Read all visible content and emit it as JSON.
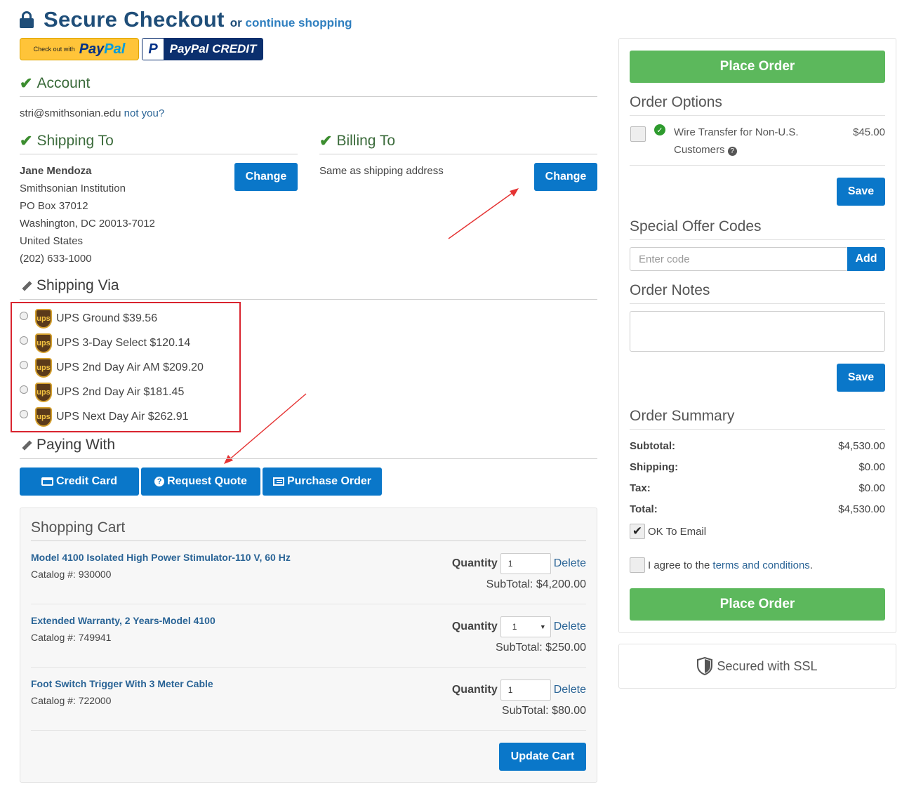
{
  "header": {
    "title": "Secure Checkout",
    "or_text": "or",
    "continue_link": "continue shopping"
  },
  "paypal": {
    "checkout_small": "Check out with",
    "pay": "Pay",
    "pal": "Pal",
    "credit_mark": "P",
    "credit_label": "PayPal CREDIT"
  },
  "account": {
    "heading": "Account",
    "email": "stri@smithsonian.edu",
    "not_you": "not you?"
  },
  "shipping_to": {
    "heading": "Shipping To",
    "name": "Jane Mendoza",
    "lines": [
      "Smithsonian Institution",
      "PO Box 37012",
      "Washington, DC 20013-7012",
      "United States",
      "(202) 633-1000"
    ],
    "change": "Change"
  },
  "billing_to": {
    "heading": "Billing To",
    "text": "Same as shipping address",
    "change": "Change"
  },
  "shipping_via": {
    "heading": "Shipping Via",
    "logo": "ups",
    "options": [
      "UPS Ground $39.56",
      "UPS 3-Day Select $120.14",
      "UPS 2nd Day Air AM $209.20",
      "UPS 2nd Day Air $181.45",
      "UPS Next Day Air $262.91"
    ]
  },
  "paying_with": {
    "heading": "Paying With",
    "credit_card": "Credit Card",
    "request_quote": "Request Quote",
    "purchase_order": "Purchase Order"
  },
  "cart": {
    "title": "Shopping Cart",
    "quantity_label": "Quantity",
    "delete_label": "Delete",
    "items": [
      {
        "name": "Model 4100 Isolated High Power Stimulator-110 V, 60 Hz",
        "catalog": "Catalog #: 930000",
        "qty": "1",
        "subtotal": "SubTotal: $4,200.00"
      },
      {
        "name": "Extended Warranty, 2 Years-Model 4100",
        "catalog": "Catalog #: 749941",
        "qty": "1",
        "subtotal": "SubTotal: $250.00"
      },
      {
        "name": "Foot Switch Trigger With 3 Meter Cable",
        "catalog": "Catalog #: 722000",
        "qty": "1",
        "subtotal": "SubTotal: $80.00"
      }
    ],
    "update": "Update Cart"
  },
  "sidebar": {
    "place_order": "Place Order",
    "order_options": {
      "heading": "Order Options",
      "option_label_1": "Wire Transfer for Non-U.S.",
      "option_label_2": "Customers",
      "option_price": "$45.00",
      "save": "Save"
    },
    "offer": {
      "heading": "Special Offer Codes",
      "placeholder": "Enter code",
      "add": "Add"
    },
    "notes": {
      "heading": "Order Notes",
      "save": "Save"
    },
    "summary": {
      "heading": "Order Summary",
      "rows": [
        {
          "label": "Subtotal:",
          "value": "$4,530.00"
        },
        {
          "label": "Shipping:",
          "value": "$0.00"
        },
        {
          "label": "Tax:",
          "value": "$0.00"
        },
        {
          "label": "Total:",
          "value": "$4,530.00"
        }
      ],
      "ok_email": "OK To Email",
      "agree_prefix": "I agree to the",
      "terms": "terms and conditions",
      "agree_suffix": "."
    },
    "ssl": "Secured with SSL"
  }
}
